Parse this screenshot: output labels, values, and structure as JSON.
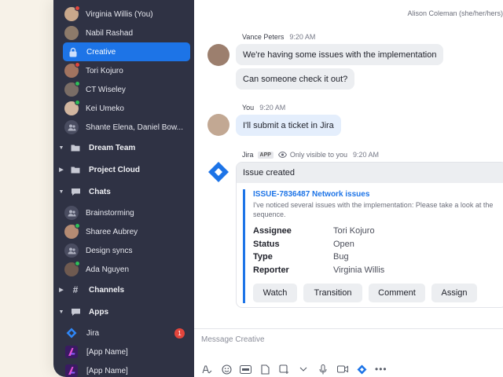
{
  "header": {
    "current_user": "Alison Coleman (she/her/hers)"
  },
  "sidebar": {
    "top_items": [
      {
        "label": "Virginia Willis (You)",
        "kind": "person",
        "status": "red"
      },
      {
        "label": "Nabil Rashad",
        "kind": "person",
        "status": "none"
      },
      {
        "label": "Creative",
        "kind": "channel-locked",
        "status": "none",
        "active": true
      },
      {
        "label": "Tori Kojuro",
        "kind": "person",
        "status": "red"
      },
      {
        "label": "CT Wiseley",
        "kind": "person",
        "status": "green"
      },
      {
        "label": "Kei Umeko",
        "kind": "person",
        "status": "green"
      },
      {
        "label": "Shante Elena, Daniel Bow...",
        "kind": "group",
        "status": "none"
      }
    ],
    "sections": {
      "dream_team": "Dream Team",
      "project_cloud": "Project Cloud",
      "chats": "Chats",
      "channels": "Channels",
      "apps": "Apps"
    },
    "chat_items": [
      {
        "label": "Brainstorming",
        "kind": "group",
        "status": "none"
      },
      {
        "label": "Sharee Aubrey",
        "kind": "person",
        "status": "green"
      },
      {
        "label": "Design syncs",
        "kind": "group",
        "status": "none"
      },
      {
        "label": "Ada Nguyen",
        "kind": "person",
        "status": "green"
      }
    ],
    "app_items": [
      {
        "label": "Jira",
        "icon": "jira-icon",
        "badge": "1"
      },
      {
        "label": "[App Name]",
        "icon": "app-icon"
      },
      {
        "label": "[App Name]",
        "icon": "app-icon"
      }
    ]
  },
  "messages": [
    {
      "sender": "Vance Peters",
      "time": "9:20 AM",
      "lines": [
        "We're having some issues with the implementation",
        "Can someone check it out?"
      ]
    },
    {
      "sender": "You",
      "time": "9:20 AM",
      "lines": [
        "I'll submit a ticket in Jira"
      ]
    }
  ],
  "jira_message": {
    "sender": "Jira",
    "tag": "APP",
    "visibility": "Only visible to you",
    "time": "9:20 AM",
    "card_header": "Issue created",
    "issue_title": "ISSUE-7836487 Network issues",
    "issue_desc": "I've noticed several issues with the implementation: Please take a look at the sequence.",
    "fields": [
      {
        "key": "Assignee",
        "value": "Tori Kojuro"
      },
      {
        "key": "Status",
        "value": "Open"
      },
      {
        "key": "Type",
        "value": "Bug"
      },
      {
        "key": "Reporter",
        "value": "Virginia Willis"
      }
    ],
    "buttons": [
      "Watch",
      "Transition",
      "Comment",
      "Assign"
    ]
  },
  "composer": {
    "placeholder": "Message Creative"
  },
  "colors": {
    "accent": "#1d74e7",
    "sidebar": "#2f3244",
    "online": "#2fbf58",
    "alert": "#e2453c"
  }
}
